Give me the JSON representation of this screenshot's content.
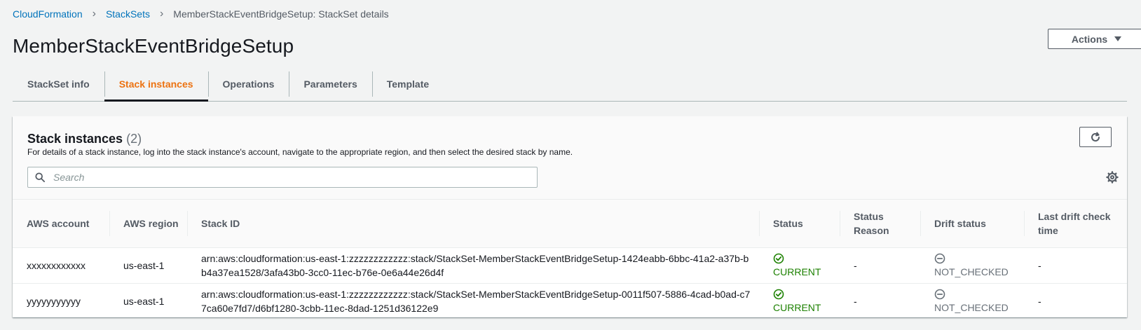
{
  "breadcrumb": {
    "items": [
      "CloudFormation",
      "StackSets"
    ],
    "current": "MemberStackEventBridgeSetup: StackSet details"
  },
  "page": {
    "title": "MemberStackEventBridgeSetup",
    "actions_label": "Actions"
  },
  "tabs": [
    {
      "label": "StackSet info",
      "active": false
    },
    {
      "label": "Stack instances",
      "active": true
    },
    {
      "label": "Operations",
      "active": false
    },
    {
      "label": "Parameters",
      "active": false
    },
    {
      "label": "Template",
      "active": false
    }
  ],
  "panel": {
    "title": "Stack instances",
    "count": "(2)",
    "description": "For details of a stack instance, log into the stack instance's account, navigate to the appropriate region, and then select the desired stack by name.",
    "search_placeholder": "Search"
  },
  "table": {
    "columns": [
      "AWS account",
      "AWS region",
      "Stack ID",
      "Status",
      "Status Reason",
      "Drift status",
      "Last drift check time"
    ],
    "rows": [
      {
        "account": "xxxxxxxxxxxx",
        "region": "us-east-1",
        "stack_id": "arn:aws:cloudformation:us-east-1:zzzzzzzzzzzz:stack/StackSet-MemberStackEventBridgeSetup-1424eabb-6bbc-41a2-a37b-bb4a37ea1528/3afa43b0-3cc0-11ec-b76e-0e6a44e26d4f",
        "status": "CURRENT",
        "status_reason": "-",
        "drift_status": "NOT_CHECKED",
        "last_drift": "-"
      },
      {
        "account": "yyyyyyyyyyy",
        "region": "us-east-1",
        "stack_id": "arn:aws:cloudformation:us-east-1:zzzzzzzzzzzz:stack/StackSet-MemberStackEventBridgeSetup-0011f507-5886-4cad-b0ad-c77ca60e7fd7/d6bf1280-3cbb-11ec-8dad-1251d36122e9",
        "status": "CURRENT",
        "status_reason": "-",
        "drift_status": "NOT_CHECKED",
        "last_drift": "-"
      }
    ]
  },
  "colors": {
    "link": "#0073bb",
    "active_tab": "#ec7211",
    "success": "#1d8102",
    "muted": "#687078"
  },
  "icons": [
    "chevron-right-icon",
    "caret-down-icon",
    "refresh-icon",
    "search-icon",
    "gear-icon",
    "check-circle-icon",
    "minus-circle-icon"
  ]
}
